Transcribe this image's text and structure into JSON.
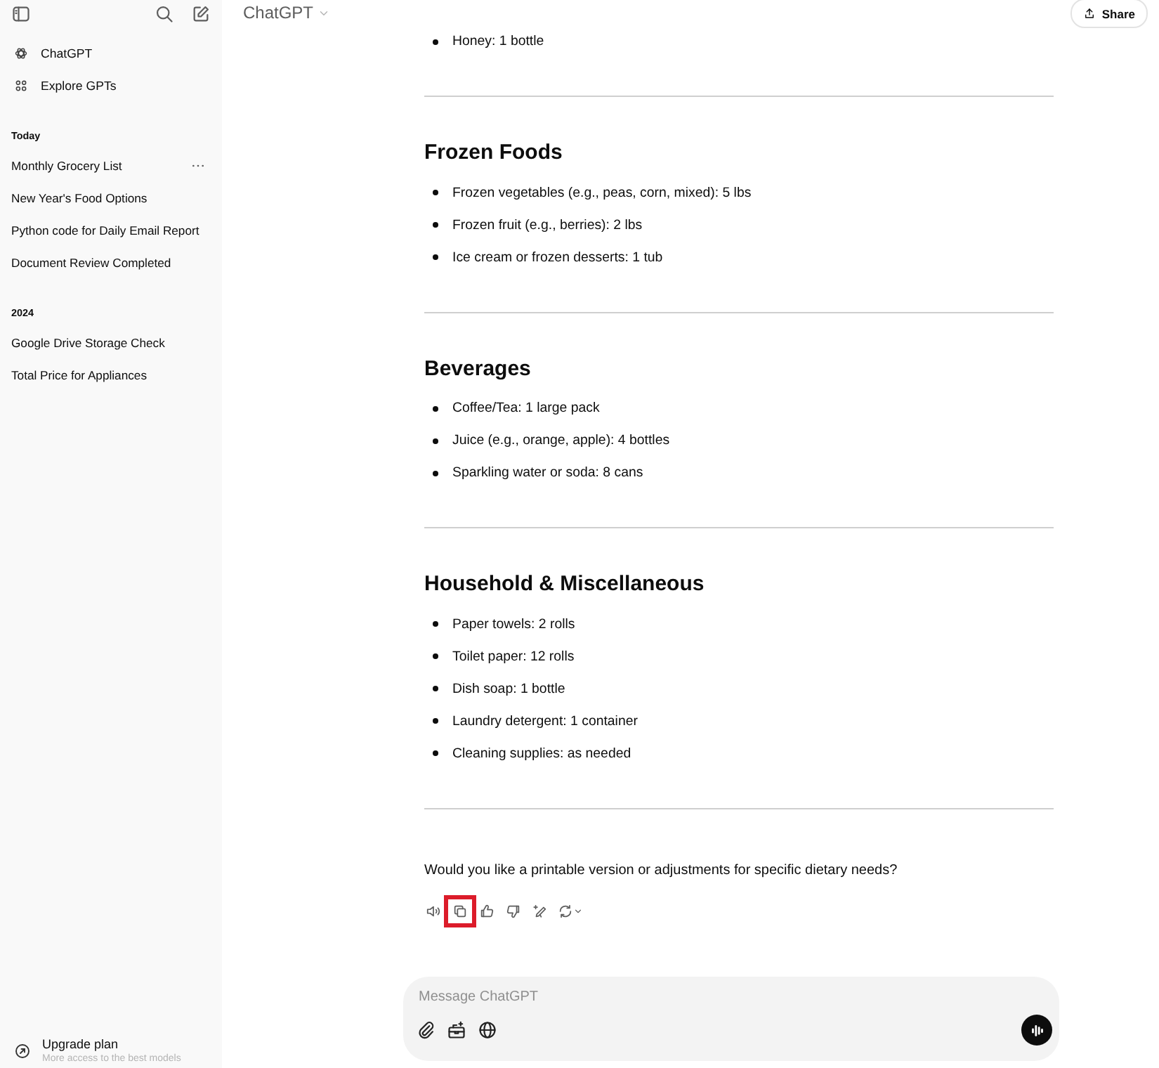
{
  "sidebar": {
    "nav": [
      {
        "kind": "logo",
        "label": "ChatGPT"
      },
      {
        "kind": "grid",
        "label": "Explore GPTs"
      }
    ],
    "groups": [
      {
        "heading": "Today",
        "chats": [
          {
            "title": "Monthly Grocery List",
            "options_visible": true
          },
          {
            "title": "New Year's Food Options",
            "options_visible": false
          },
          {
            "title": "Python code for Daily Email Report",
            "options_visible": false
          },
          {
            "title": "Document Review Completed",
            "options_visible": false
          }
        ]
      },
      {
        "heading": "2024",
        "chats": [
          {
            "title": "Google Drive Storage Check",
            "options_visible": false
          },
          {
            "title": "Total Price for Appliances",
            "options_visible": false
          }
        ]
      }
    ],
    "upgrade": {
      "title": "Upgrade plan",
      "subtitle": "More access to the best models"
    }
  },
  "header": {
    "model": "ChatGPT",
    "share": "Share"
  },
  "message": {
    "intro_items": [
      "Honey: 1 bottle"
    ],
    "sections": [
      {
        "heading": "Frozen Foods",
        "items": [
          "Frozen vegetables (e.g., peas, corn, mixed): 5 lbs",
          "Frozen fruit (e.g., berries): 2 lbs",
          "Ice cream or frozen desserts: 1 tub"
        ]
      },
      {
        "heading": "Beverages",
        "items": [
          "Coffee/Tea: 1 large pack",
          "Juice (e.g., orange, apple): 4 bottles",
          "Sparkling water or soda: 8 cans"
        ]
      },
      {
        "heading": "Household & Miscellaneous",
        "items": [
          "Paper towels: 2 rolls",
          "Toilet paper: 12 rolls",
          "Dish soap: 1 bottle",
          "Laundry detergent: 1 container",
          "Cleaning supplies: as needed"
        ]
      }
    ],
    "closing": "Would you like a printable version or adjustments for specific dietary needs?"
  },
  "actions": [
    {
      "kind": "read_aloud",
      "highlighted": false
    },
    {
      "kind": "copy",
      "highlighted": true
    },
    {
      "kind": "like",
      "highlighted": false
    },
    {
      "kind": "dislike",
      "highlighted": false
    },
    {
      "kind": "edit",
      "highlighted": false
    },
    {
      "kind": "regenerate",
      "highlighted": false
    }
  ],
  "composer": {
    "placeholder": "Message ChatGPT"
  }
}
